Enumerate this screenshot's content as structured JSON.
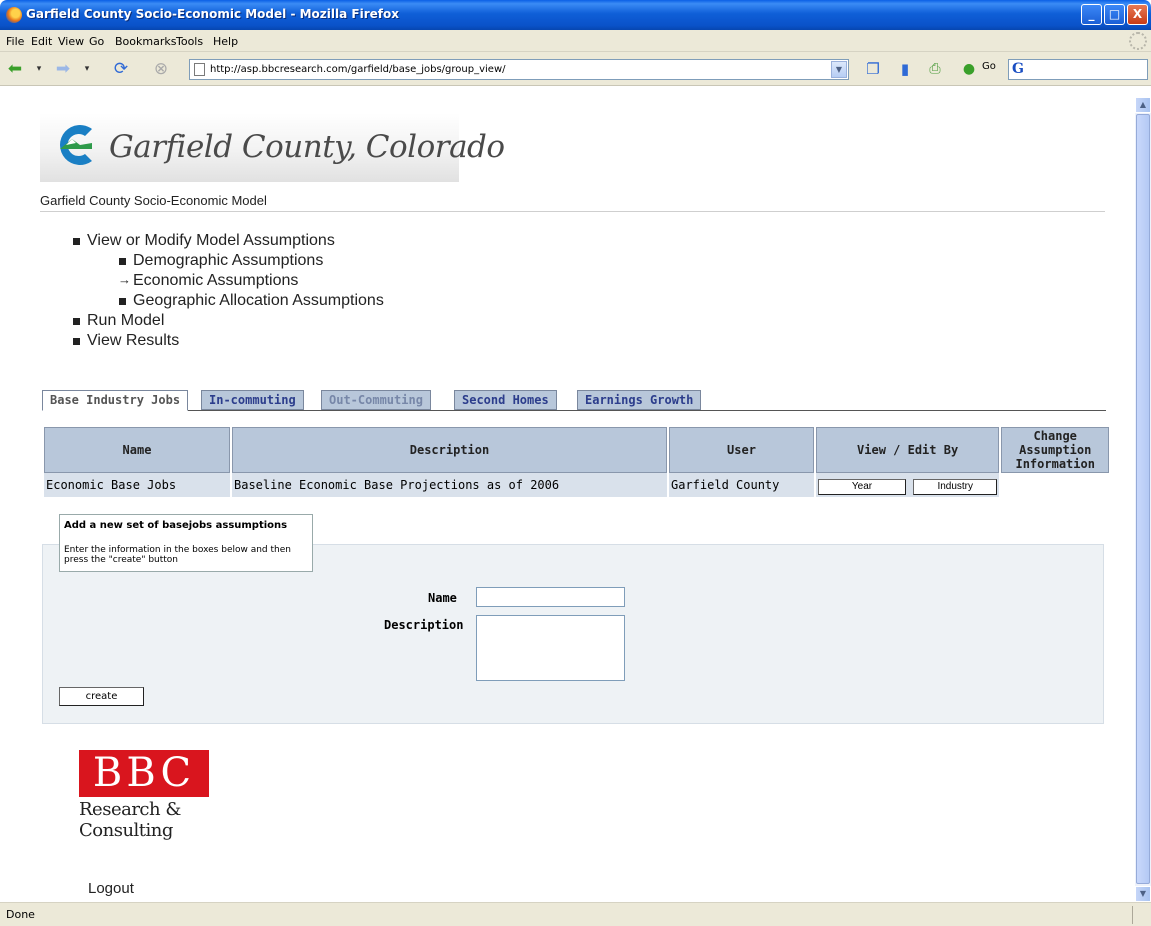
{
  "window": {
    "title": "Garfield County Socio-Economic Model - Mozilla Firefox",
    "controls": [
      "_",
      "□",
      "X"
    ]
  },
  "menu": [
    "File",
    "Edit",
    "View",
    "Go",
    "Bookmarks",
    "Tools",
    "Help"
  ],
  "toolbar": {
    "url": "http://asp.bbcresearch.com/garfield/base_jobs/group_view/",
    "go_label": "Go",
    "search_logo": "G"
  },
  "page": {
    "logo_text": "Garfield County, Colorado",
    "subheading": "Garfield County Socio-Economic Model",
    "nav": {
      "assumptions": "View or Modify Model Assumptions",
      "demographic": "Demographic Assumptions",
      "economic": "Economic Assumptions",
      "geographic": "Geographic Allocation Assumptions",
      "run_model": "Run Model",
      "view_results": "View Results"
    },
    "tabs": [
      "Base Industry Jobs",
      "In-commuting",
      "Out-Commuting",
      "Second Homes",
      "Earnings Growth"
    ],
    "table": {
      "headers": [
        "Name",
        "Description",
        "User",
        "View / Edit By",
        "Change Assumption Information"
      ],
      "rows": [
        {
          "name": "Economic Base Jobs",
          "description": "Baseline Economic Base Projections as of 2006",
          "user": "Garfield County",
          "view_year": "Year",
          "view_industry": "Industry"
        }
      ]
    },
    "form": {
      "title": "Add a new set of basejobs assumptions",
      "instructions": "Enter the information in the boxes below and then press the \"create\" button",
      "name_label": "Name",
      "description_label": "Description",
      "create_label": "create"
    },
    "bbc_logo": {
      "letters": "BBC",
      "line1": "Research &",
      "line2": "Consulting"
    },
    "logout": "Logout"
  },
  "status": "Done",
  "colors": {
    "titlebar": "#0a52c9",
    "tab_active_text": "#555555",
    "tab_inactive_bg": "#b8c7da",
    "header_bg": "#b8c7da",
    "row_bg": "#d9e1eb",
    "form_panel_bg": "#eef2f5",
    "bbc_red": "#d9151e"
  }
}
